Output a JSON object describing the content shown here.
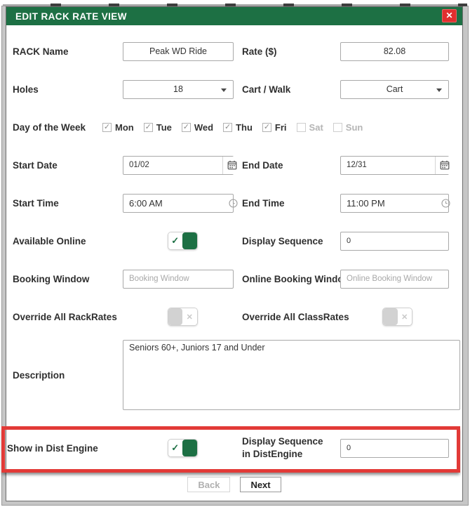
{
  "window": {
    "title": "EDIT RACK RATE VIEW"
  },
  "icons": {
    "check": "✓",
    "x": "✕",
    "close": "✕"
  },
  "theme": {
    "header_green": "#1d7044",
    "toggle_green": "#1d7044",
    "close_red": "#e12f2f",
    "highlight_red": "#e23a37"
  },
  "form": {
    "rack_name": {
      "label": "RACK Name",
      "value": "Peak WD Ride"
    },
    "rate": {
      "label": "Rate ($)",
      "value": "82.08"
    },
    "holes": {
      "label": "Holes",
      "value": "18"
    },
    "cart_walk": {
      "label": "Cart / Walk",
      "value": "Cart"
    },
    "day_of_week": {
      "label": "Day of the Week",
      "days": [
        {
          "label": "Mon",
          "checked": true,
          "enabled": true
        },
        {
          "label": "Tue",
          "checked": true,
          "enabled": true
        },
        {
          "label": "Wed",
          "checked": true,
          "enabled": true
        },
        {
          "label": "Thu",
          "checked": true,
          "enabled": true
        },
        {
          "label": "Fri",
          "checked": true,
          "enabled": true
        },
        {
          "label": "Sat",
          "checked": false,
          "enabled": false
        },
        {
          "label": "Sun",
          "checked": false,
          "enabled": false
        }
      ]
    },
    "start_date": {
      "label": "Start Date",
      "value": "01/02"
    },
    "end_date": {
      "label": "End Date",
      "value": "12/31"
    },
    "start_time": {
      "label": "Start Time",
      "value": "6:00 AM"
    },
    "end_time": {
      "label": "End Time",
      "value": "11:00 PM"
    },
    "available_online": {
      "label": "Available Online",
      "on": true
    },
    "display_sequence": {
      "label": "Display Sequence",
      "value": "0"
    },
    "booking_window": {
      "label": "Booking Window",
      "placeholder": "Booking Window"
    },
    "online_booking_window": {
      "label": "Online Booking Window",
      "placeholder": "Online Booking Window"
    },
    "override_rackrates": {
      "label": "Override All RackRates",
      "on": false
    },
    "override_classrates": {
      "label": "Override All ClassRates",
      "on": false
    },
    "description": {
      "label": "Description",
      "value": "Seniors 60+, Juniors 17 and Under"
    },
    "show_in_dist_engine": {
      "label": "Show in Dist Engine",
      "on": true
    },
    "display_sequence_distengine": {
      "label": "Display Sequence in DistEngine",
      "value": "0"
    }
  },
  "footer": {
    "back_label": "Back",
    "next_label": "Next",
    "back_enabled": false
  }
}
